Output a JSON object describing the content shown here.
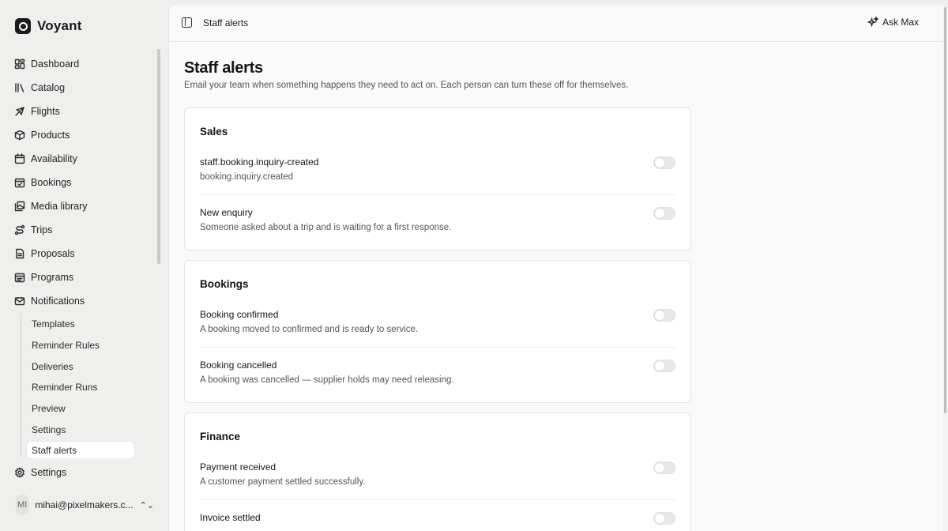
{
  "brand": {
    "name": "Voyant"
  },
  "nav": [
    {
      "label": "Dashboard",
      "icon": "dashboard-icon"
    },
    {
      "label": "Catalog",
      "icon": "library-icon"
    },
    {
      "label": "Flights",
      "icon": "plane-icon"
    },
    {
      "label": "Products",
      "icon": "package-icon"
    },
    {
      "label": "Availability",
      "icon": "calendar-icon"
    },
    {
      "label": "Bookings",
      "icon": "calendar-check-icon"
    },
    {
      "label": "Media library",
      "icon": "images-icon"
    },
    {
      "label": "Trips",
      "icon": "route-icon"
    },
    {
      "label": "Proposals",
      "icon": "file-text-icon"
    },
    {
      "label": "Programs",
      "icon": "calendar-range-icon"
    },
    {
      "label": "Notifications",
      "icon": "mail-icon"
    }
  ],
  "notifications_sub": [
    {
      "label": "Templates"
    },
    {
      "label": "Reminder Rules"
    },
    {
      "label": "Deliveries"
    },
    {
      "label": "Reminder Runs"
    },
    {
      "label": "Preview"
    },
    {
      "label": "Settings"
    },
    {
      "label": "Staff alerts",
      "active": true
    }
  ],
  "nav_settings": {
    "label": "Settings",
    "icon": "gear-icon"
  },
  "user": {
    "initials": "MI",
    "email": "mihai@pixelmakers.c..."
  },
  "topbar": {
    "breadcrumb": "Staff alerts",
    "ask_label": "Ask Max"
  },
  "page": {
    "title": "Staff alerts",
    "subtitle": "Email your team when something happens they need to act on. Each person can turn these off for themselves."
  },
  "sections": [
    {
      "title": "Sales",
      "items": [
        {
          "title": "staff.booking.inquiry-created",
          "desc": "booking.inquiry.created",
          "enabled": false
        },
        {
          "title": "New enquiry",
          "desc": "Someone asked about a trip and is waiting for a first response.",
          "enabled": false
        }
      ]
    },
    {
      "title": "Bookings",
      "items": [
        {
          "title": "Booking confirmed",
          "desc": "A booking moved to confirmed and is ready to service.",
          "enabled": false
        },
        {
          "title": "Booking cancelled",
          "desc": "A booking was cancelled — supplier holds may need releasing.",
          "enabled": false
        }
      ]
    },
    {
      "title": "Finance",
      "items": [
        {
          "title": "Payment received",
          "desc": "A customer payment settled successfully.",
          "enabled": false
        },
        {
          "title": "Invoice settled",
          "desc": "",
          "enabled": false
        }
      ]
    }
  ]
}
